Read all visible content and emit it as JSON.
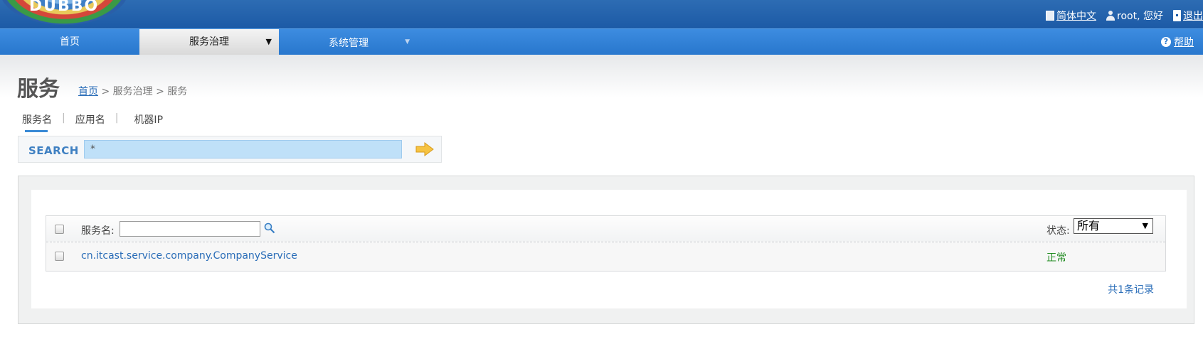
{
  "header": {
    "logo_text": "DUBBO",
    "language_link": "简体中文",
    "user_text": "root, 您好",
    "logout_link": "退出"
  },
  "menu": {
    "items": [
      {
        "label": "首页"
      },
      {
        "label": "服务治理",
        "arrow": "▼"
      },
      {
        "label": "系统管理",
        "arrow": "▼"
      }
    ],
    "help_label": "帮助",
    "help_icon": "?"
  },
  "page": {
    "title": "服务",
    "breadcrumb": {
      "home": "首页",
      "rest": " > 服务治理 > 服务"
    }
  },
  "search": {
    "tabs": [
      "服务名",
      "应用名",
      "机器IP"
    ],
    "separator": "|",
    "active_tab": "服务名",
    "label": "SEARCH",
    "value": "*"
  },
  "table": {
    "filter_label": "服务名:",
    "filter_value": "",
    "state_label": "状态:",
    "state_selected": "所有",
    "state_arrow": "▼",
    "rows": [
      {
        "service": "cn.itcast.service.company.CompanyService",
        "status": "正常"
      }
    ],
    "total": "共1条记录"
  },
  "colors": {
    "header_bg": "#1c5aa6",
    "menu_bg": "#2877cd",
    "link": "#2a6db8",
    "status_ok": "#1e8a1e",
    "search_input_bg": "#bfe0f8"
  }
}
